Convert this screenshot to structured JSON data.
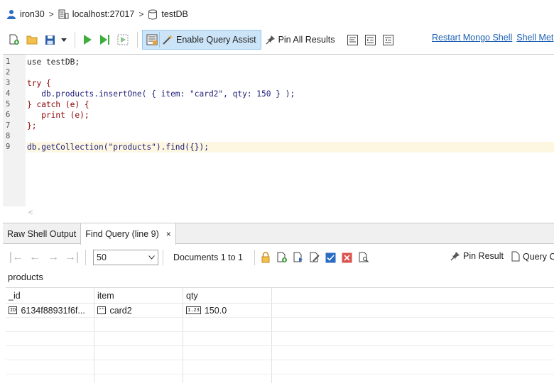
{
  "breadcrumb": {
    "user": "iron30",
    "server": "localhost:27017",
    "database": "testDB"
  },
  "toolbar": {
    "assist_label": "Enable Query Assist",
    "pin_all_label": "Pin All Results",
    "restart_label": "Restart Mongo Shell",
    "shell_label": "Shell Met"
  },
  "editor": {
    "line_numbers": [
      "1",
      "2",
      "3",
      "4",
      "5",
      "6",
      "7",
      "8",
      "9"
    ],
    "lines": [
      "use testDB;",
      "",
      "try {",
      "   db.products.insertOne( { item: \"card2\", qty: 150 } );",
      "} catch (e) {",
      "   print (e);",
      "};",
      "",
      "db.getCollection(\"products\").find({});"
    ]
  },
  "tabs": {
    "raw": "Raw Shell Output",
    "find": "Find Query (line 9)",
    "close": "×"
  },
  "results_toolbar": {
    "limit_value": "50",
    "docs_label": "Documents 1 to 1",
    "pin_result_label": "Pin Result",
    "query_code_label": "Query C"
  },
  "collection": "products",
  "table": {
    "columns": [
      "_id",
      "item",
      "qty"
    ],
    "rows": [
      {
        "id": "6134f88931f6f...",
        "item": "card2",
        "qty": "150.0",
        "id_badge": "ID",
        "item_badge": "\"\"",
        "qty_badge": "1.23"
      }
    ]
  },
  "colors": {
    "accent_link": "#1a5fb4",
    "assist_bg": "#cce4f7",
    "keyword": "#8b0000",
    "string": "#2a00ff"
  }
}
